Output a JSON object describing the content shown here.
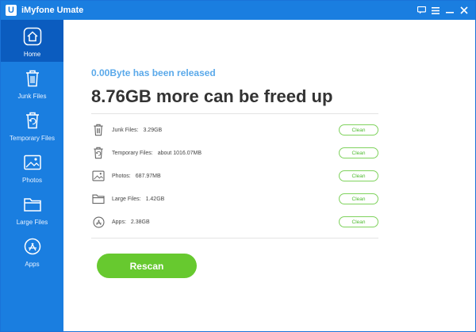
{
  "window": {
    "title": "iMyfone Umate",
    "logo_letter": "U",
    "controls": [
      "feedback-icon",
      "menu-icon",
      "minimize-icon",
      "close-icon"
    ]
  },
  "sidebar": {
    "items": [
      {
        "label": "Home",
        "icon": "home-icon",
        "active": true
      },
      {
        "label": "Junk Files",
        "icon": "trash-icon",
        "active": false
      },
      {
        "label": "Temporary Files",
        "icon": "temp-files-icon",
        "active": false
      },
      {
        "label": "Photos",
        "icon": "photo-icon",
        "active": false
      },
      {
        "label": "Large Files",
        "icon": "folder-icon",
        "active": false
      },
      {
        "label": "Apps",
        "icon": "app-store-icon",
        "active": false
      }
    ]
  },
  "main": {
    "released_text": "0.00Byte has been released",
    "freed_text": "8.76GB more can be freed up",
    "rows": [
      {
        "label": "Junk Files:",
        "value": "3.29GB",
        "icon": "trash-icon",
        "button": "Clean"
      },
      {
        "label": "Temporary Files:",
        "value": "about 1016.07MB",
        "icon": "temp-files-icon",
        "button": "Clean"
      },
      {
        "label": "Photos:",
        "value": "687.97MB",
        "icon": "photo-icon",
        "button": "Clean"
      },
      {
        "label": "Large Files:",
        "value": "1.42GB",
        "icon": "folder-icon",
        "button": "Clean"
      },
      {
        "label": "Apps:",
        "value": "2.38GB",
        "icon": "app-store-icon",
        "button": "Clean"
      }
    ],
    "rescan_label": "Rescan"
  },
  "colors": {
    "brand_blue": "#1a7ee0",
    "active_blue": "#0b5cbf",
    "accent_green": "#67c92f",
    "released_blue": "#5aa9ea"
  }
}
